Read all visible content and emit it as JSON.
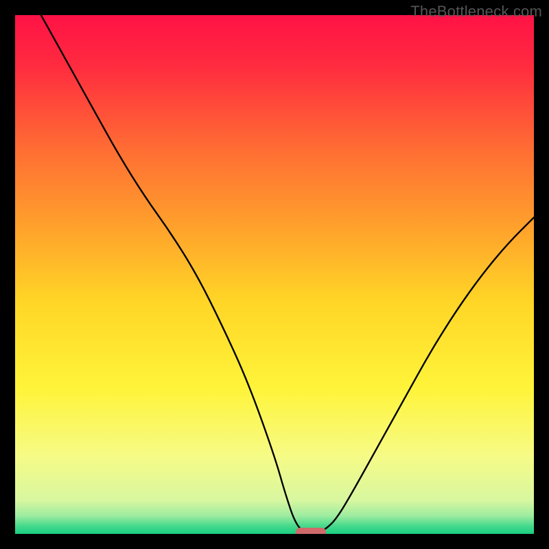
{
  "watermark": "TheBottleneck.com",
  "chart_data": {
    "type": "line",
    "title": "",
    "xlabel": "",
    "ylabel": "",
    "xlim": [
      0,
      100
    ],
    "ylim": [
      0,
      100
    ],
    "series": [
      {
        "name": "bottleneck-curve",
        "x": [
          5,
          10,
          15,
          20,
          25,
          30,
          35,
          40,
          45,
          50,
          52,
          54,
          56,
          58,
          60,
          62,
          65,
          70,
          75,
          80,
          85,
          90,
          95,
          100
        ],
        "values": [
          100,
          91,
          82,
          73,
          65,
          58,
          50,
          40,
          29,
          15,
          8,
          2,
          0,
          0,
          1,
          3,
          8,
          17,
          26,
          35,
          43,
          50,
          56,
          61
        ]
      }
    ],
    "marker": {
      "name": "optimal-point",
      "x": 57,
      "value": 0,
      "color": "#D06A6A"
    },
    "gradient_stops": [
      {
        "offset": 0.0,
        "color": "#FF1246"
      },
      {
        "offset": 0.1,
        "color": "#FF2C3F"
      },
      {
        "offset": 0.25,
        "color": "#FF6A34"
      },
      {
        "offset": 0.4,
        "color": "#FF9E2C"
      },
      {
        "offset": 0.55,
        "color": "#FFD526"
      },
      {
        "offset": 0.72,
        "color": "#FFF43A"
      },
      {
        "offset": 0.85,
        "color": "#F6FB86"
      },
      {
        "offset": 0.935,
        "color": "#D8F7A0"
      },
      {
        "offset": 0.965,
        "color": "#9EECA0"
      },
      {
        "offset": 0.985,
        "color": "#45D98C"
      },
      {
        "offset": 1.0,
        "color": "#18CF80"
      }
    ]
  }
}
